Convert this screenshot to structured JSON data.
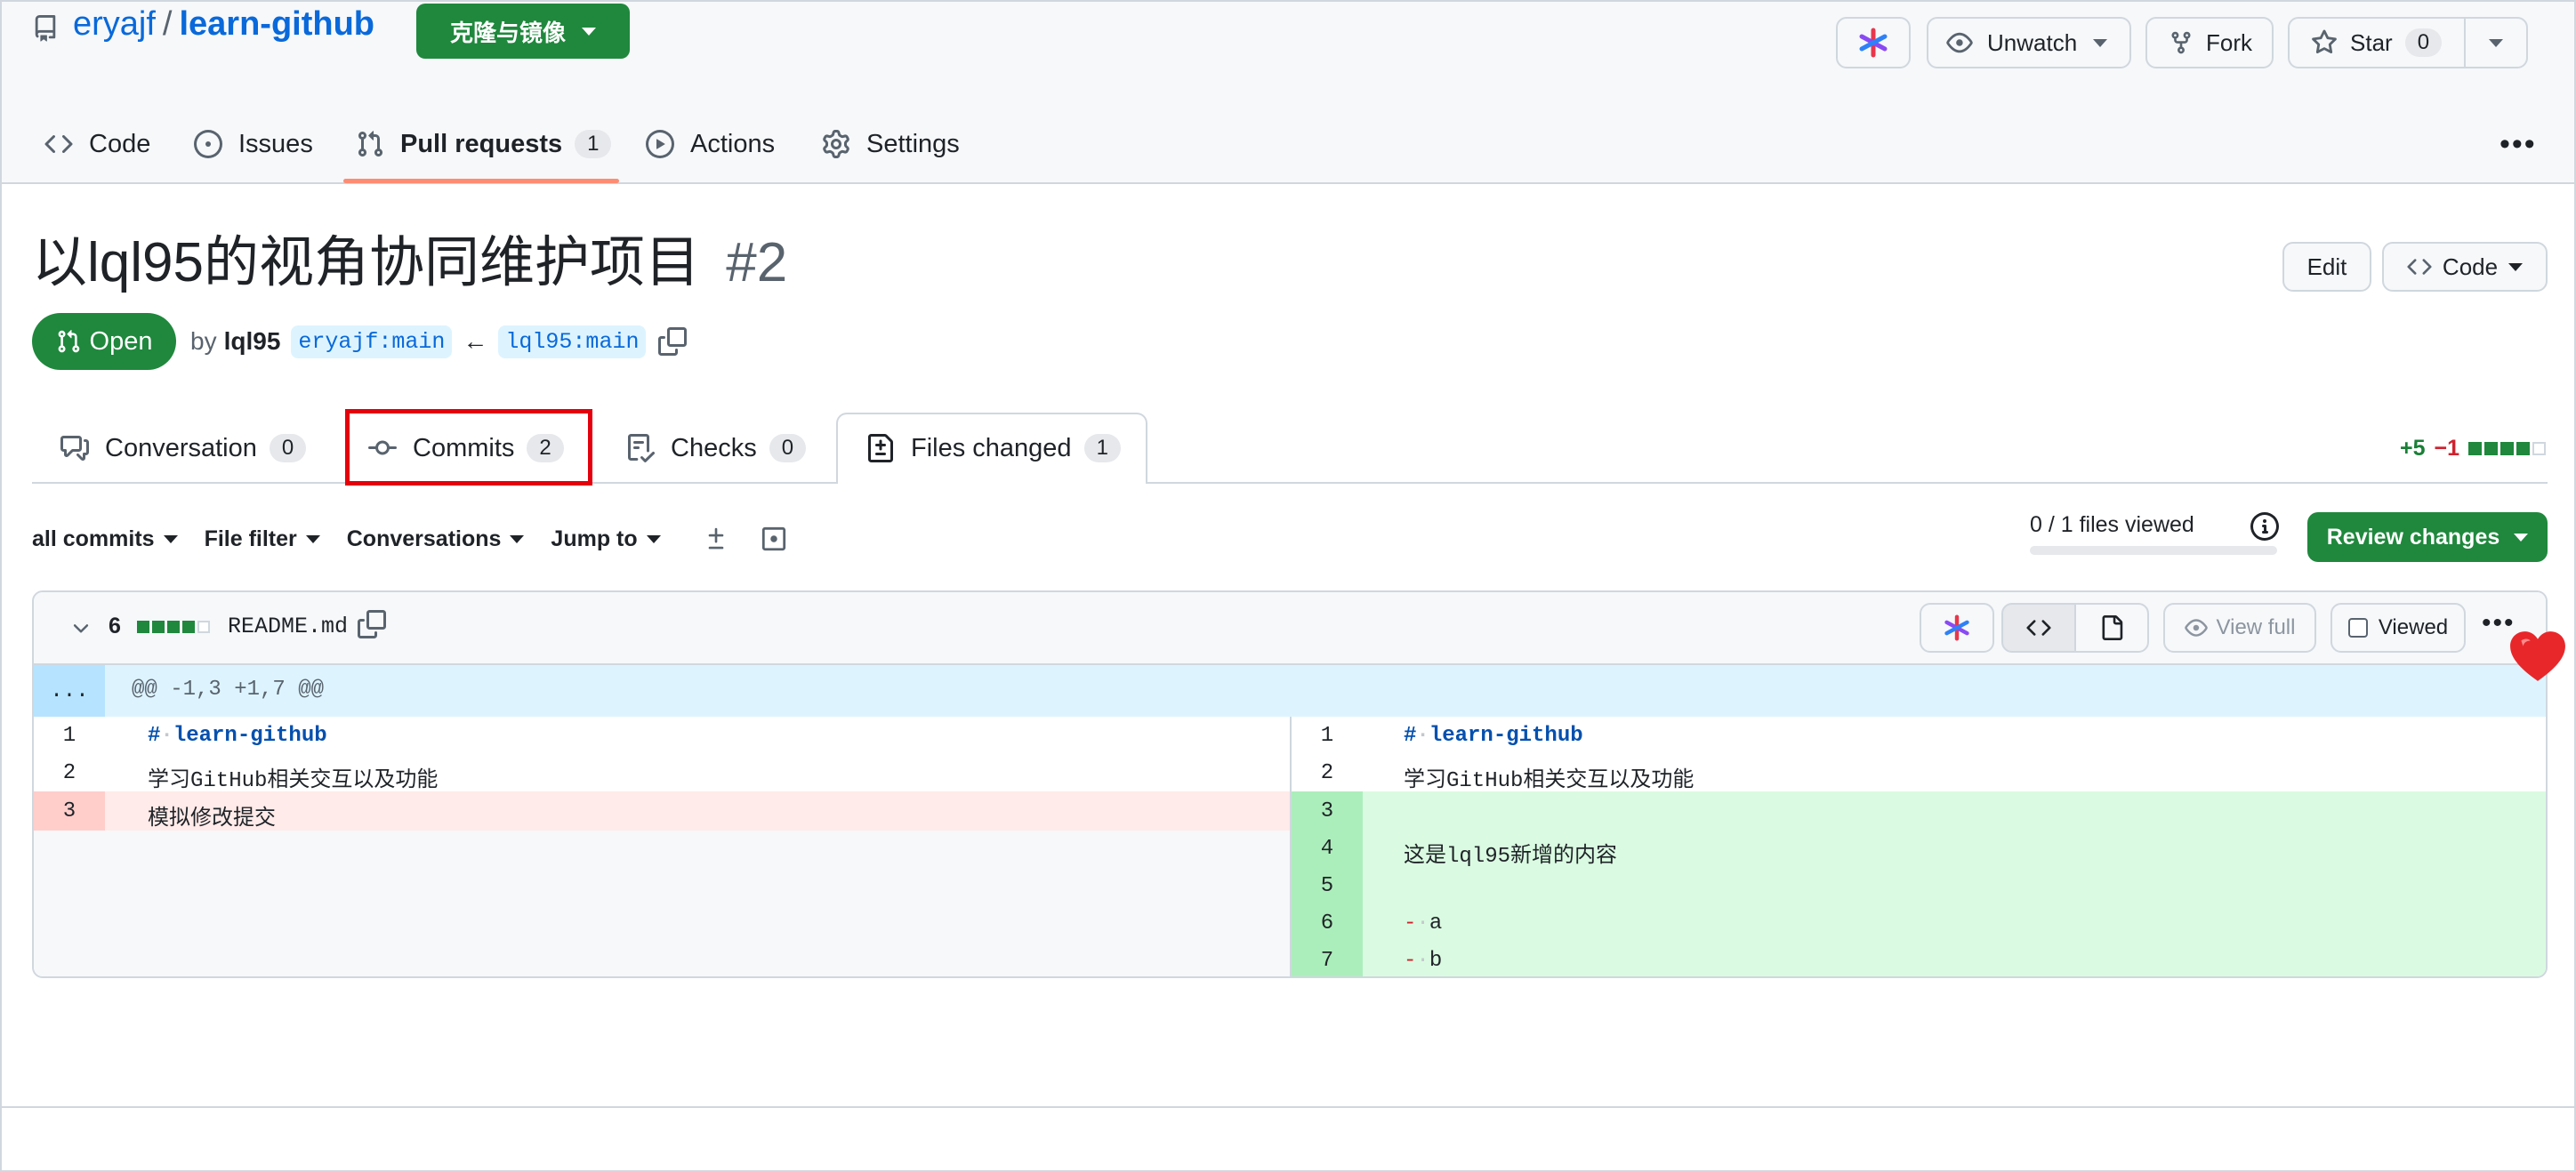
{
  "repo": {
    "owner": "eryajf",
    "separator": "/",
    "name": "learn-github",
    "clone_button": "克隆与镜像"
  },
  "header_actions": {
    "unwatch": "Unwatch",
    "fork": "Fork",
    "star": "Star",
    "star_count": "0"
  },
  "nav": {
    "code": "Code",
    "issues": "Issues",
    "pull_requests": "Pull requests",
    "pull_requests_count": "1",
    "actions": "Actions",
    "settings": "Settings"
  },
  "pr": {
    "title": "以lql95的视角协同维护项目",
    "number": "#2",
    "state": "Open",
    "by": "by",
    "author": "lql95",
    "base_branch": "eryajf:main",
    "head_branch": "lql95:main",
    "edit": "Edit",
    "code_button": "Code"
  },
  "tabs": [
    {
      "label": "Conversation",
      "count": "0"
    },
    {
      "label": "Commits",
      "count": "2"
    },
    {
      "label": "Checks",
      "count": "0"
    },
    {
      "label": "Files changed",
      "count": "1"
    }
  ],
  "diffstat": {
    "additions": "+5",
    "deletions": "−1"
  },
  "filters": {
    "all_commits": "all commits",
    "file_filter": "File filter",
    "conversations": "Conversations",
    "jump_to": "Jump to",
    "files_viewed": "0 / 1 files viewed",
    "review_changes": "Review changes"
  },
  "file": {
    "change_count": "6",
    "name": "README.md",
    "view_full": "View full",
    "viewed": "Viewed",
    "hunk_expand": "...",
    "hunk_header": "@@ -1,3 +1,7 @@"
  },
  "diff_left": [
    {
      "num": "1",
      "hash": "#",
      "text": "learn-github",
      "type": "context"
    },
    {
      "num": "2",
      "hash": "",
      "text": "学习GitHub相关交互以及功能",
      "type": "context"
    },
    {
      "num": "3",
      "hash": "",
      "text": "模拟修改提交",
      "type": "deleted"
    }
  ],
  "diff_right": [
    {
      "num": "1",
      "hash": "#",
      "text": "learn-github",
      "type": "context"
    },
    {
      "num": "2",
      "hash": "",
      "text": "学习GitHub相关交互以及功能",
      "type": "context"
    },
    {
      "num": "3",
      "hash": "",
      "text": "",
      "type": "added"
    },
    {
      "num": "4",
      "hash": "",
      "text": "这是lql95新增的内容",
      "type": "added"
    },
    {
      "num": "5",
      "hash": "",
      "text": "",
      "type": "added"
    },
    {
      "num": "6",
      "hash": "-",
      "text": "a",
      "type": "added"
    },
    {
      "num": "7",
      "hash": "-",
      "text": "b",
      "type": "added"
    }
  ],
  "colors": {
    "link": "#0969da",
    "green": "#1f883d",
    "red_outline": "#e5000d",
    "del_bg": "#ffebe9",
    "del_num_bg": "#ffcecb",
    "add_bg": "#dafbe1",
    "add_num_bg": "#aceebb",
    "hunk_bg": "#ddf4ff"
  }
}
